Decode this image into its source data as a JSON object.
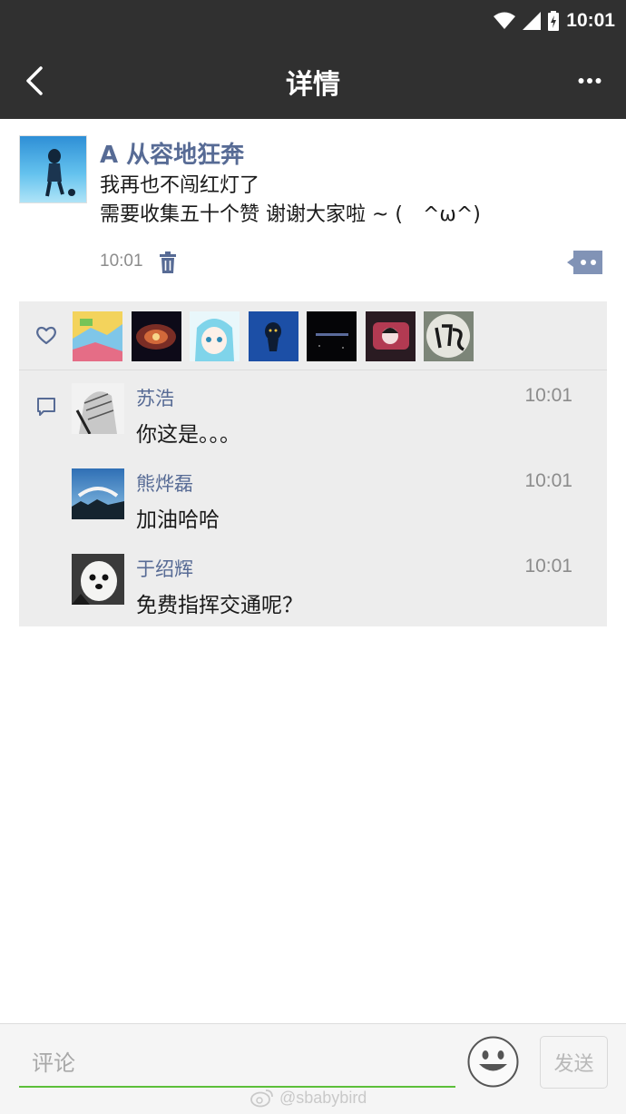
{
  "status_bar": {
    "time": "10:01",
    "icons": [
      "wifi-icon",
      "signal-icon",
      "battery-charging-icon"
    ]
  },
  "header": {
    "title": "详情",
    "back_icon": "chevron-left-icon",
    "more_icon": "more-dots-icon"
  },
  "post": {
    "author": "A 从容地狂奔",
    "lines": [
      "我再也不闯红灯了",
      "需要收集五十个赞 谢谢大家啦 ~ (　^ω^)"
    ],
    "time": "10:01",
    "delete_icon": "trash-icon",
    "comment_icon": "comment-bubble-icon"
  },
  "likes": {
    "icon": "heart-icon",
    "count_avatars": 7
  },
  "comments": [
    {
      "name": "苏浩",
      "time": "10:01",
      "text": "你这是。。。"
    },
    {
      "name": "熊烨磊",
      "time": "10:01",
      "text": "加油哈哈"
    },
    {
      "name": "于绍辉",
      "time": "10:01",
      "text": "免费指挥交通呢？"
    }
  ],
  "input_bar": {
    "placeholder": "评论",
    "send_label": "发送",
    "emoji_icon": "smiley-icon"
  },
  "watermark": {
    "text": "@sbabybird"
  },
  "colors": {
    "header_bg": "#303030",
    "link_blue": "#576b95",
    "panel_bg": "#ededed",
    "input_underline": "#5cbf3a"
  }
}
